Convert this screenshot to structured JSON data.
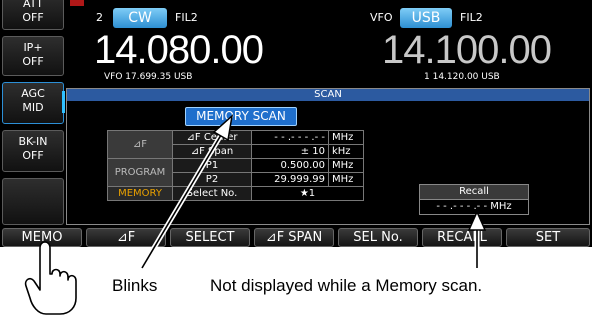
{
  "left_keys": [
    {
      "line1": "ATT",
      "line2": "OFF"
    },
    {
      "line1": "IP+",
      "line2": "OFF"
    },
    {
      "line1": "AGC",
      "line2": "MID"
    },
    {
      "line1": "BK-IN",
      "line2": "OFF"
    }
  ],
  "vfo_main": {
    "number": "2",
    "mode": "CW",
    "filter": "FIL2",
    "frequency": "14.080.00",
    "sub_info": "VFO 17.699.35 USB"
  },
  "vfo_sub": {
    "label": "VFO",
    "mode": "USB",
    "filter": "FIL2",
    "frequency": "14.100.00",
    "sub_info": "1  14.120.00  USB"
  },
  "scan_panel": {
    "title": "SCAN",
    "active_button": "MEMORY SCAN",
    "rows": [
      {
        "group": "⊿F",
        "label": "⊿F Center",
        "value": "- - .- - - .- -",
        "unit": "MHz"
      },
      {
        "group": "",
        "label": "⊿F Span",
        "value": "±   10",
        "unit": "kHz"
      },
      {
        "group": "PROGRAM",
        "label": "P1",
        "value": "0.500.00",
        "unit": "MHz"
      },
      {
        "group": "",
        "label": "P2",
        "value": "29.999.99",
        "unit": "MHz"
      },
      {
        "group": "MEMORY",
        "label": "Select No.",
        "value": "★1",
        "unit": ""
      }
    ],
    "recall_label": "Recall",
    "recall_value": "- - .- - - .- -   MHz"
  },
  "function_keys": [
    "MEMO",
    "⊿F",
    "SELECT",
    "⊿F SPAN",
    "SEL No.",
    "RECALL",
    "SET"
  ],
  "callouts": {
    "blinks": "Blinks",
    "not_displayed": "Not displayed while a Memory scan."
  },
  "colors": {
    "mode_button": "#2e8fd2",
    "panel_title": "#2c5aa0",
    "memory_label": "#e8a000",
    "screen_bg": "#000000"
  },
  "icons": [
    "hand-pointer-icon",
    "arrow-icon"
  ]
}
